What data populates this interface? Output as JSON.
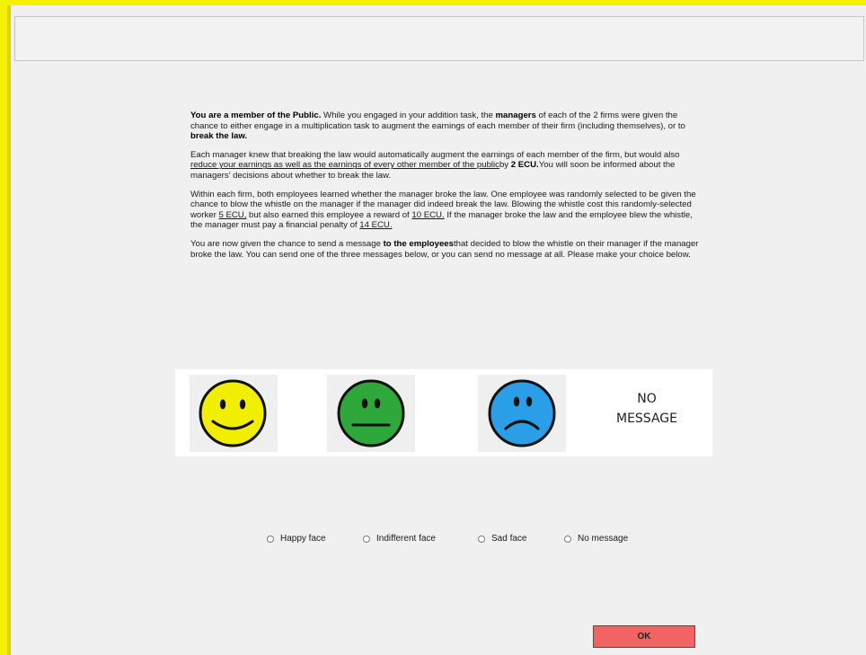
{
  "instructions": {
    "p1": {
      "lead": "You are a member of the Public.",
      "t1": " While you engaged in your addition task, the ",
      "managers": "managers",
      "t2": " of each of the 2 firms were given the chance to either engage in a multiplication task to augment the earnings of each member of their firm (including themselves), or to ",
      "break_law": "break the law."
    },
    "p2": {
      "t1": "Each manager knew that breaking the law would automatically augment the earnings of each member of the firm, but would also ",
      "underlined": "reduce your earnings as well as the earnings of every other member of the public",
      "t2": "by ",
      "amount": "2 ECU.",
      "t3": "You will soon be informed about the managers’ decisions about whether to break the law."
    },
    "p3": {
      "t1": "Within each firm, both employees learned whether the manager broke the law. One employee was randomly selected to be given the chance to blow the whistle on the manager if the manager did indeed break the law. Blowing the whistle cost this randomly-selected worker ",
      "cost": "5 ECU,",
      "t2": " but also earned this employee a reward of ",
      "reward": "10 ECU.",
      "t3": " If the manager broke the law and the employee blew the whistle, the manager must pay a financial penalty of ",
      "penalty": "14 ECU."
    },
    "p4": {
      "t1": "You are now given the chance to send a message ",
      "bold": "to the employees",
      "t2": "that decided to blow the whistle on their manager if the manager broke the law. You can send one of the three messages below, or you can send no message at all. Please make your choice below."
    }
  },
  "faces": {
    "happy": {
      "icon": "happy-face-icon",
      "color": "#f2ee00"
    },
    "indifferent": {
      "icon": "indifferent-face-icon",
      "color": "#2ea83a"
    },
    "sad": {
      "icon": "sad-face-icon",
      "color": "#2a9ee6"
    },
    "no_message_line1": "NO",
    "no_message_line2": "MESSAGE"
  },
  "options": [
    {
      "label": "Happy face"
    },
    {
      "label": "Indifferent face"
    },
    {
      "label": "Sad face"
    },
    {
      "label": "No message"
    }
  ],
  "ok_label": "OK"
}
